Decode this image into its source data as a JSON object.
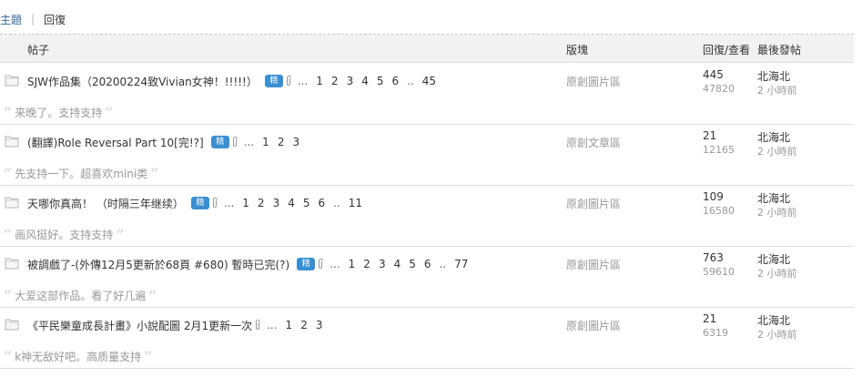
{
  "tabs": {
    "topics": "主題",
    "separator": "|",
    "replies": "回復"
  },
  "header": {
    "post": "帖子",
    "forum": "版塊",
    "reply_view": "回復/查看",
    "last_post": "最後發帖"
  },
  "rows": [
    {
      "title": "SJW作品集（20200224致Vivian女神！!!!!!）",
      "badge": "img-badge-icon",
      "badge_label": "精",
      "pages": [
        "...",
        "1",
        "2",
        "3",
        "4",
        "5",
        "6",
        "..",
        "45"
      ],
      "forum": "原創圖片區",
      "replies": "445",
      "views": "47820",
      "last_author": "北海北",
      "last_time": "2 小時前",
      "quote": "来晚了。支持支持"
    },
    {
      "title": "(翻譯)Role Reversal Part 10[完!?]",
      "badge": "img-badge-icon",
      "badge_label": "精",
      "pages": [
        "...",
        "1",
        "2",
        "3"
      ],
      "forum": "原創文章區",
      "replies": "21",
      "views": "12165",
      "last_author": "北海北",
      "last_time": "2 小時前",
      "quote": "先支持一下。超喜欢mini类"
    },
    {
      "title": "天哪你真高！ （时隔三年继续）",
      "badge": "img-badge-icon",
      "badge_label": "精",
      "pages": [
        "...",
        "1",
        "2",
        "3",
        "4",
        "5",
        "6",
        "..",
        "11"
      ],
      "forum": "原創圖片區",
      "replies": "109",
      "views": "16580",
      "last_author": "北海北",
      "last_time": "2 小時前",
      "quote": "画风挺好。支持支持"
    },
    {
      "title": "被調戲了-(外傳12月5更新於68頁 #680) 暫時已完(?)",
      "badge": "img-badge-icon",
      "badge_label": "精",
      "pages": [
        "...",
        "1",
        "2",
        "3",
        "4",
        "5",
        "6",
        "..",
        "77"
      ],
      "forum": "原創圖片區",
      "replies": "763",
      "views": "59610",
      "last_author": "北海北",
      "last_time": "2 小時前",
      "quote": "大爱这部作品。看了好几遍"
    },
    {
      "title": "《平民樂童成長計畫》小說配圖 2月1更新一次",
      "badge": "",
      "badge_label": "",
      "pages": [
        "...",
        "1",
        "2",
        "3"
      ],
      "forum": "原創圖片區",
      "replies": "21",
      "views": "6319",
      "last_author": "北海北",
      "last_time": "2 小時前",
      "quote": "k神无敌好吧。高质量支持"
    }
  ],
  "colors": {
    "link": "#336699",
    "muted": "#999999",
    "badge": "#3b8fd1",
    "header_bg": "#f2f2f2"
  }
}
